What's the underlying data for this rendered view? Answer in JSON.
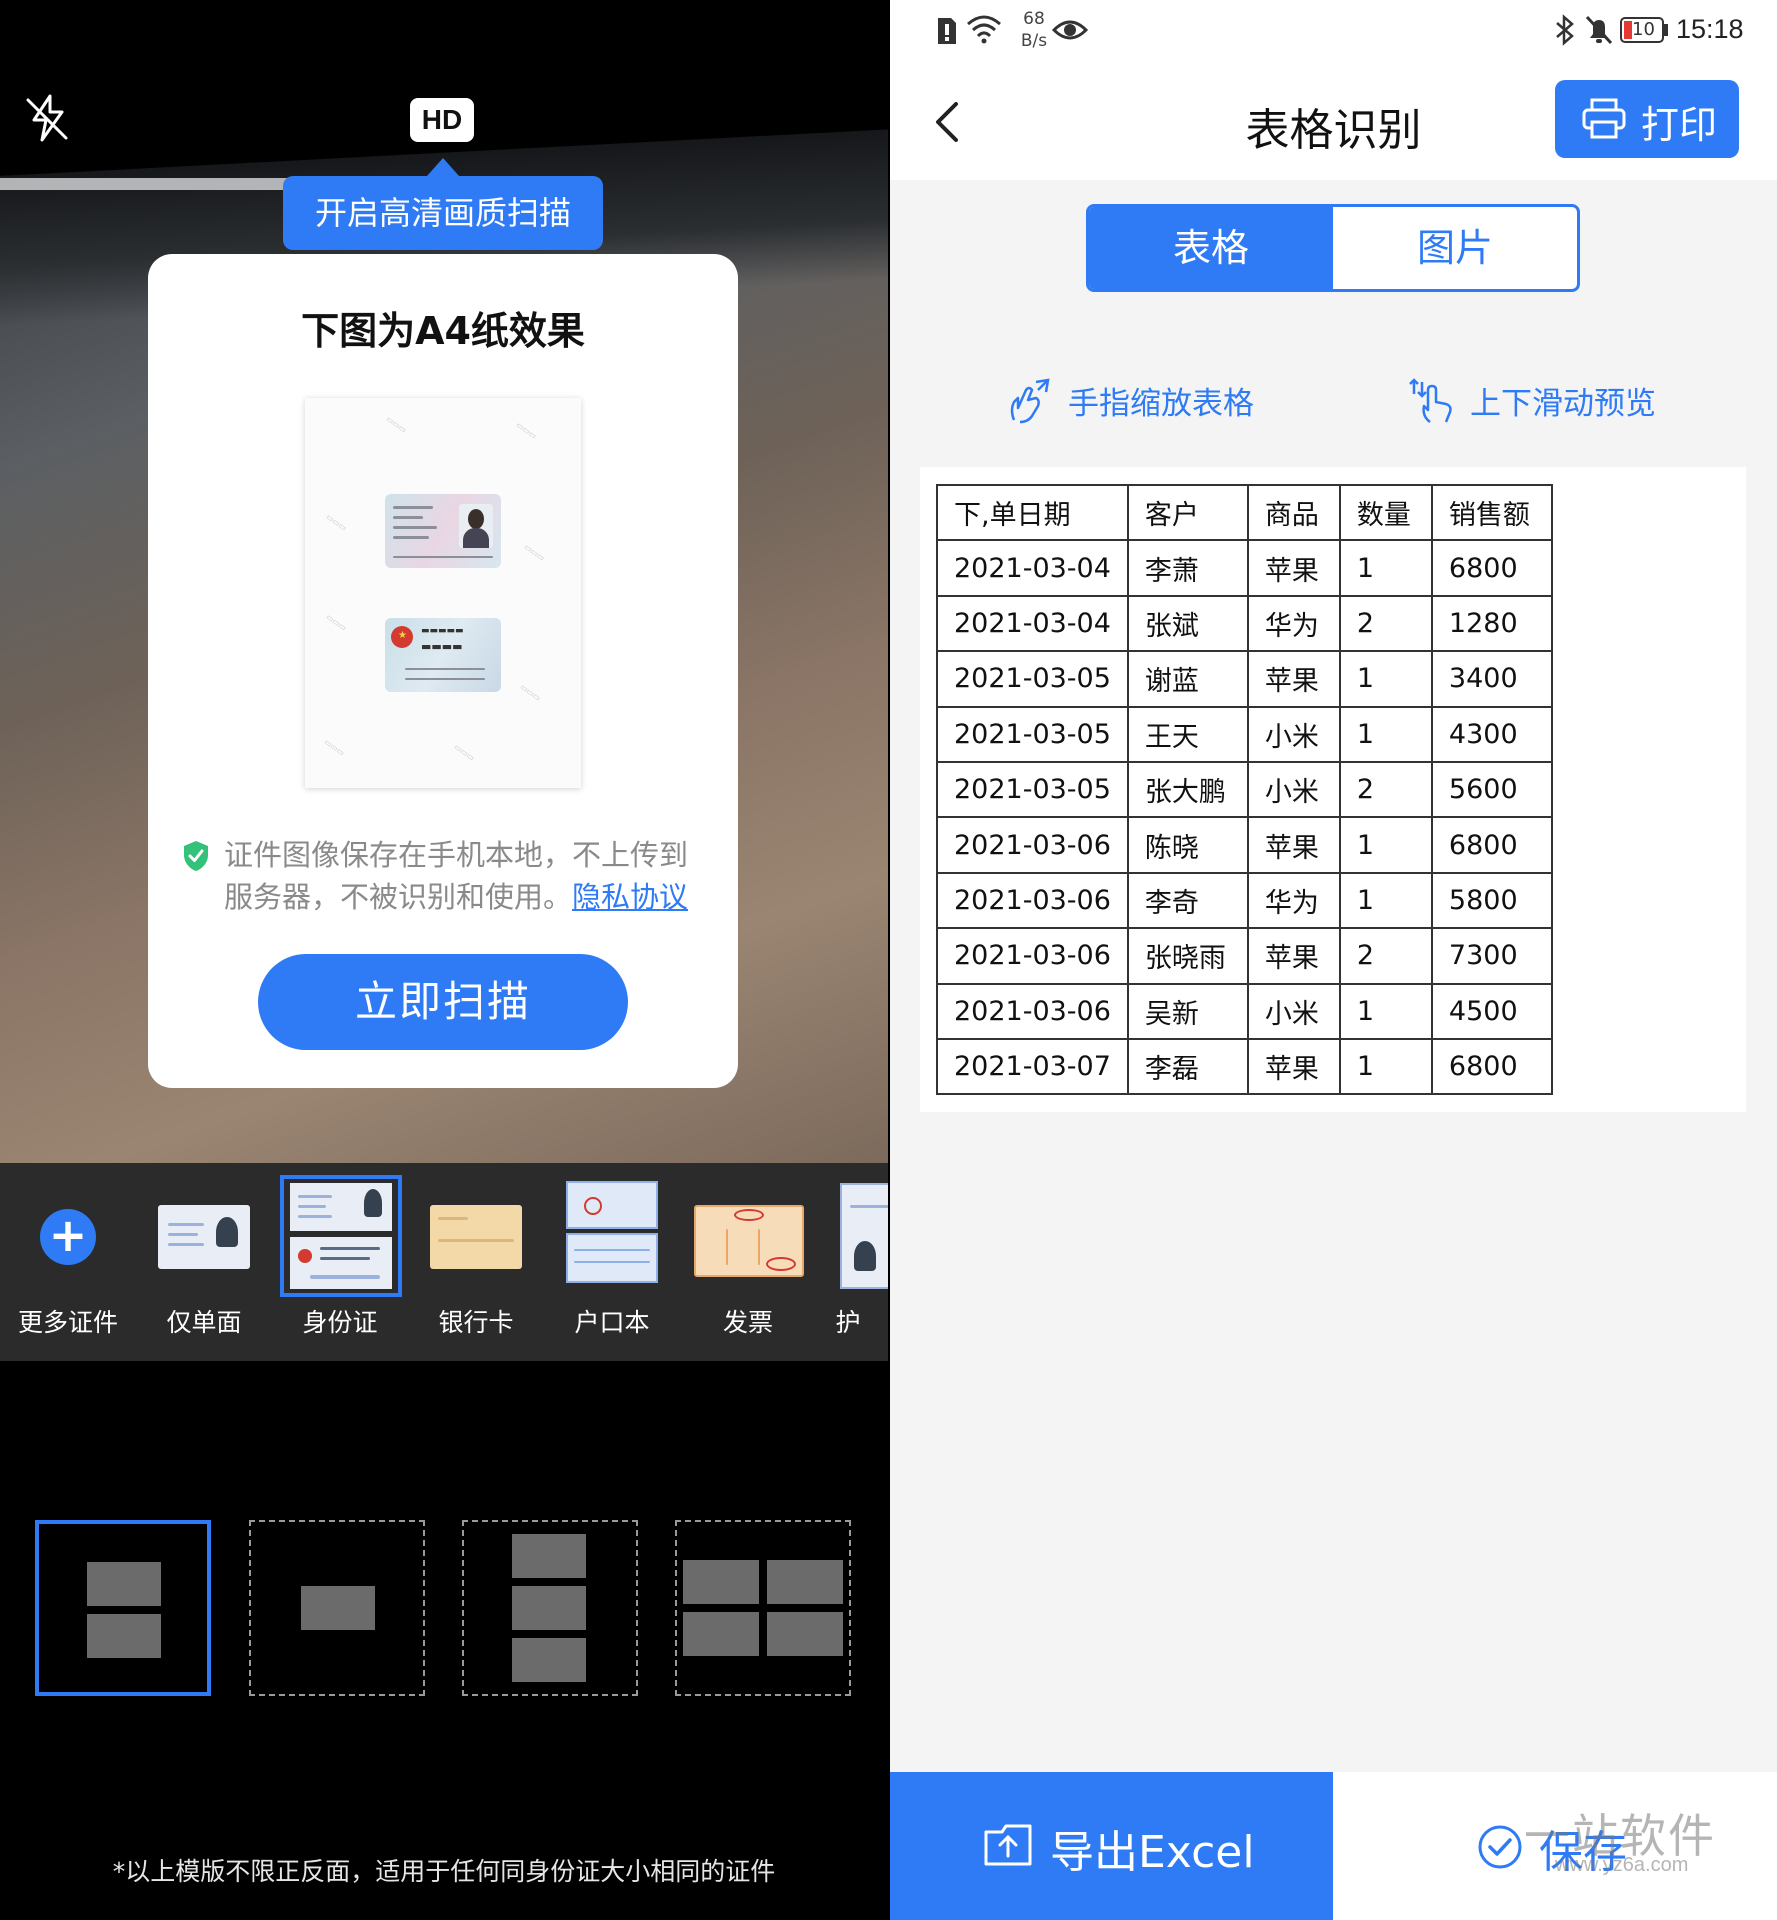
{
  "camera": {
    "hd_label": "HD",
    "hd_tooltip": "开启高清画质扫描",
    "popup": {
      "title": "下图为A4纸效果",
      "privacy_text": "证件图像保存在手机本地，不上传到服务器，不被识别和使用。",
      "privacy_link": "隐私协议",
      "scan_button": "立即扫描"
    },
    "doc_types": [
      {
        "label": "更多证件"
      },
      {
        "label": "仅单面"
      },
      {
        "label": "身份证",
        "selected": true
      },
      {
        "label": "银行卡"
      },
      {
        "label": "户口本"
      },
      {
        "label": "发票"
      },
      {
        "label": "护"
      }
    ],
    "template_note": "*以上模版不限正反面，适用于任何同身份证大小相同的证件"
  },
  "status_bar": {
    "net_speed_value": "68",
    "net_speed_unit": "B/s",
    "battery": "10",
    "time": "15:18"
  },
  "table_recognition": {
    "title": "表格识别",
    "print_label": "打印",
    "tabs": [
      {
        "label": "表格",
        "active": true
      },
      {
        "label": "图片",
        "active": false
      }
    ],
    "hint_zoom": "手指缩放表格",
    "hint_scroll": "上下滑动预览",
    "table": {
      "headers": [
        "下,单日期",
        "客户",
        "商品",
        "数量",
        "销售额"
      ],
      "rows": [
        [
          "2021-03-04",
          "李萧",
          "苹果",
          "1",
          "6800"
        ],
        [
          "2021-03-04",
          "张斌",
          "华为",
          "2",
          "1280"
        ],
        [
          "2021-03-05",
          "谢蓝",
          "苹果",
          "1",
          "3400"
        ],
        [
          "2021-03-05",
          "王天",
          "小米",
          "1",
          "4300"
        ],
        [
          "2021-03-05",
          "张大鹏",
          "小米",
          "2",
          "5600"
        ],
        [
          "2021-03-06",
          "陈晓",
          "苹果",
          "1",
          "6800"
        ],
        [
          "2021-03-06",
          "李奇",
          "华为",
          "1",
          "5800"
        ],
        [
          "2021-03-06",
          "张晓雨",
          "苹果",
          "2",
          "7300"
        ],
        [
          "2021-03-06",
          "吴新",
          "小米",
          "1",
          "4500"
        ],
        [
          "2021-03-07",
          "李磊",
          "苹果",
          "1",
          "6800"
        ]
      ]
    },
    "export_label": "导出Excel",
    "save_label": "保存"
  },
  "watermark": {
    "site": "一站软件",
    "url": "www.yz6a.com"
  },
  "colors": {
    "accent": "#2f7bf5",
    "shield": "#34c27a"
  }
}
